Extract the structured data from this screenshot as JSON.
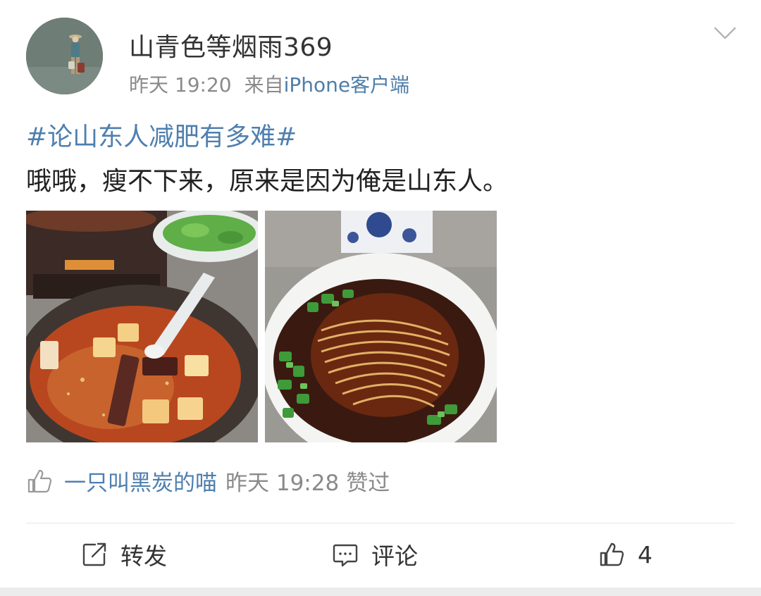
{
  "post": {
    "username": "山青色等烟雨369",
    "time": "昨天 19:20",
    "source_prefix": "来自",
    "source": "iPhone客户端",
    "hashtag": "#论山东人减肥有多难#",
    "text": "哦哦，瘦不下来，原来是因为俺是山东人。",
    "images": [
      "tofu-claypot-photo",
      "noodle-soup-photo"
    ]
  },
  "likes_line": {
    "liker": "一只叫黑炭的喵",
    "time": "昨天 19:28",
    "action": "赞过"
  },
  "actions": {
    "forward_label": "转发",
    "comment_label": "评论",
    "like_count": "4"
  },
  "icons": {
    "more": "chevron-down-icon",
    "forward": "share-icon",
    "comment": "comment-icon",
    "like": "thumbs-up-icon"
  },
  "colors": {
    "link": "#4f7fae",
    "muted": "#8a8a8a",
    "text": "#222222"
  }
}
